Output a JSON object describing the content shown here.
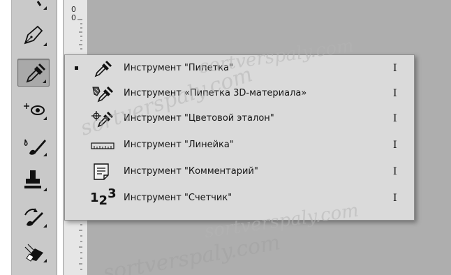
{
  "ruler": {
    "top_labels": [
      "0",
      "0"
    ]
  },
  "toolbar": {
    "tools": [
      {
        "name": "brush-tool-partial",
        "icon": "brush-icon"
      },
      {
        "name": "pen-tool",
        "icon": "pen-icon"
      },
      {
        "name": "eyedropper-tool",
        "icon": "eyedropper-icon",
        "selected": true
      },
      {
        "name": "spot-healing-tool",
        "icon": "healing-icon"
      },
      {
        "name": "brush-tool",
        "icon": "brush-icon"
      },
      {
        "name": "clone-stamp-tool",
        "icon": "stamp-icon"
      },
      {
        "name": "history-brush-tool",
        "icon": "history-brush-icon"
      },
      {
        "name": "eraser-tool",
        "icon": "eraser-icon"
      }
    ]
  },
  "flyout": {
    "items": [
      {
        "label": "Инструмент \"Пипетка\"",
        "shortcut": "I",
        "icon": "eyedropper-icon",
        "active": true
      },
      {
        "label": "Инструмент «Пипетка 3D-материала»",
        "shortcut": "I",
        "icon": "3d-material-eyedropper-icon"
      },
      {
        "label": "Инструмент \"Цветовой эталон\"",
        "shortcut": "I",
        "icon": "color-sampler-icon"
      },
      {
        "label": "Инструмент \"Линейка\"",
        "shortcut": "I",
        "icon": "ruler-icon"
      },
      {
        "label": "Инструмент \"Комментарий\"",
        "shortcut": "I",
        "icon": "note-icon"
      },
      {
        "label": "Инструмент \"Счетчик\"",
        "shortcut": "I",
        "icon": "counter-icon",
        "glyph": [
          "1",
          "2",
          "3"
        ]
      }
    ]
  },
  "watermark": {
    "text": "sortverspaly.com"
  },
  "colors": {
    "toolbar": "#c9c9c9",
    "menu": "#dadada",
    "canvas": "#aeaeae",
    "ruler": "#e6e6e6"
  }
}
